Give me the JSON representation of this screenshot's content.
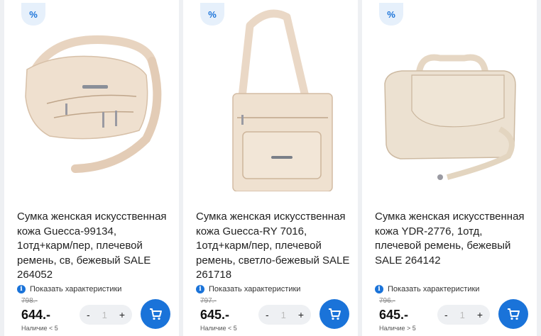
{
  "products": [
    {
      "discount_badge": "%",
      "title": "Сумка женская искусственная кожа Guecca-99134, 1отд+карм/пер, плечевой ремень, св, бежевый SALE 264052",
      "characteristics_link": "Показать характеристики",
      "old_price": "798.-",
      "price": "644.-",
      "stock": "Наличие < 5",
      "qty_minus": "-",
      "qty_value": "1",
      "qty_plus": "+"
    },
    {
      "discount_badge": "%",
      "title": "Сумка женская искусственная кожа Guecca-RY 7016, 1отд+карм/пер, плечевой ремень, светло-бежевый SALE 261718",
      "characteristics_link": "Показать характеристики",
      "old_price": "797.-",
      "price": "645.-",
      "stock": "Наличие < 5",
      "qty_minus": "-",
      "qty_value": "1",
      "qty_plus": "+"
    },
    {
      "discount_badge": "%",
      "title": "Сумка женская искусственная кожа YDR-2776, 1отд, плечевой ремень, бежевый SALE 264142",
      "characteristics_link": "Показать характеристики",
      "old_price": "796.-",
      "price": "645.-",
      "stock": "Наличие > 5",
      "qty_minus": "-",
      "qty_value": "1",
      "qty_plus": "+"
    }
  ],
  "icons": {
    "info": "info-icon",
    "cart": "cart-icon",
    "discount": "percent-icon"
  },
  "colors": {
    "accent": "#1a73d9",
    "bag_beige": "#ecdccb",
    "bag_shadow": "#d6c1aa"
  }
}
